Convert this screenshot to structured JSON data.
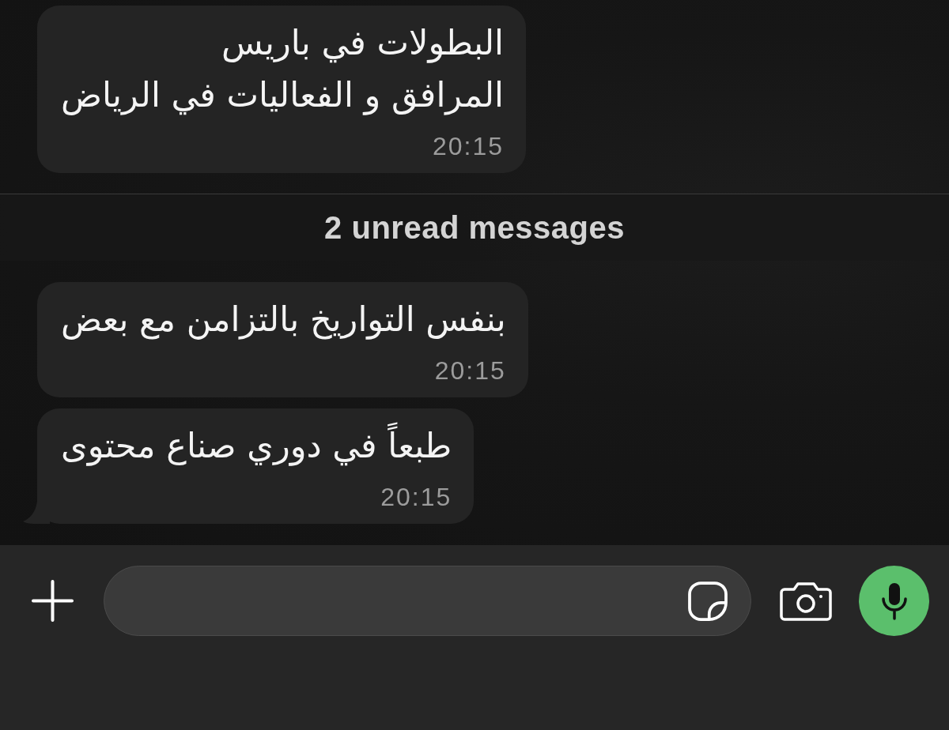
{
  "chat": {
    "items": [
      {
        "kind": "message",
        "text": "البطولات في باريس\nالمرافق و الفعاليات في الرياض",
        "time": "20:15",
        "tail": false
      },
      {
        "kind": "divider",
        "text": "2 unread messages"
      },
      {
        "kind": "message",
        "text": "بنفس التواريخ بالتزامن مع بعض",
        "time": "20:15",
        "tail": false
      },
      {
        "kind": "message",
        "text": "طبعاً في دوري صناع محتوى",
        "time": "20:15",
        "tail": true
      }
    ]
  }
}
